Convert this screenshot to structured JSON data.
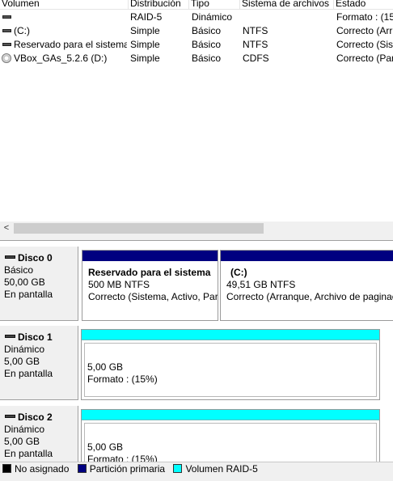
{
  "columns": [
    "Volumen",
    "Distribución",
    "Tipo",
    "Sistema de archivos",
    "Estado"
  ],
  "volumes": [
    {
      "name": "",
      "layout": "RAID-5",
      "type": "Dinámico",
      "fs": "",
      "status": "Formato : (15",
      "icon": "volume-icon"
    },
    {
      "name": "(C:)",
      "layout": "Simple",
      "type": "Básico",
      "fs": "NTFS",
      "status": "Correcto (Arr",
      "icon": "volume-icon"
    },
    {
      "name": "Reservado para el sistema",
      "layout": "Simple",
      "type": "Básico",
      "fs": "NTFS",
      "status": "Correcto (Sist",
      "icon": "volume-icon"
    },
    {
      "name": "VBox_GAs_5.2.6 (D:)",
      "layout": "Simple",
      "type": "Básico",
      "fs": "CDFS",
      "status": "Correcto (Par",
      "icon": "cd-icon"
    }
  ],
  "scrollbar": {
    "left_arrow": "<"
  },
  "disks": [
    {
      "title": "Disco 0",
      "kind": "Básico",
      "size": "50,00 GB",
      "state": "En pantalla",
      "partitions": [
        {
          "name": "Reservado para el sistema",
          "size": "500 MB NTFS",
          "status": "Correcto (Sistema, Activo, Par"
        },
        {
          "name": "(C:)",
          "size": "49,51 GB NTFS",
          "status": "Correcto (Arranque, Archivo de paginac"
        }
      ]
    },
    {
      "title": "Disco 1",
      "kind": "Dinámico",
      "size": "5,00 GB",
      "state": "En pantalla",
      "partitions": [
        {
          "size": "5,00 GB",
          "status": "Formato : (15%)"
        }
      ]
    },
    {
      "title": "Disco 2",
      "kind": "Dinámico",
      "size": "5,00 GB",
      "state": "En pantalla",
      "partitions": [
        {
          "size": "5,00 GB",
          "status": "Formato : (15%)"
        }
      ]
    }
  ],
  "legend": [
    {
      "label": "No asignado",
      "color": "#000000"
    },
    {
      "label": "Partición primaria",
      "color": "#000080"
    },
    {
      "label": "Volumen RAID-5",
      "color": "#00ffff"
    }
  ]
}
